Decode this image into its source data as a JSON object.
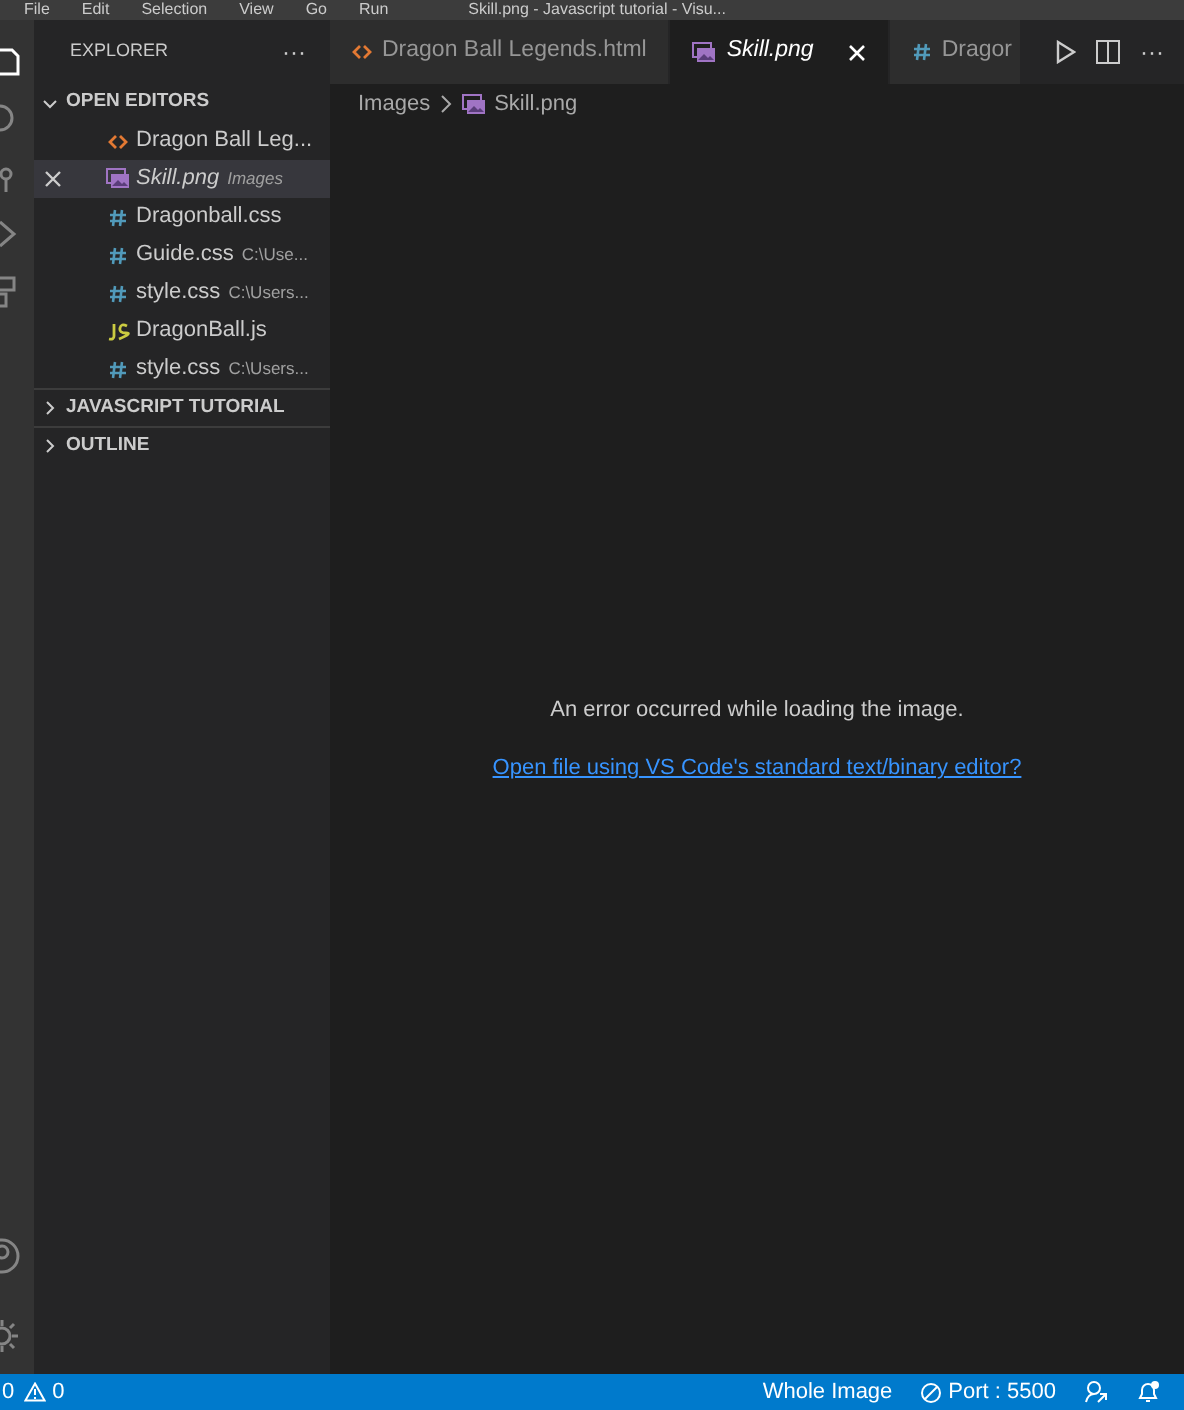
{
  "title_bar": {
    "menu": [
      "File",
      "Edit",
      "Selection",
      "View",
      "Go",
      "Run"
    ],
    "title": "Skill.png - Javascript tutorial - Visu..."
  },
  "sidebar": {
    "title": "EXPLORER",
    "more": "···",
    "sections": [
      {
        "label": "OPEN EDITORS",
        "expanded": true,
        "items": [
          {
            "name": "Dragon Ball Leg...",
            "kind": "html",
            "selected": false,
            "italic": false
          },
          {
            "name": "Skill.png",
            "kind": "image",
            "detail": "Images",
            "selected": true,
            "italic": true
          },
          {
            "name": "Dragonball.css",
            "kind": "css",
            "selected": false,
            "italic": false
          },
          {
            "name": "Guide.css",
            "kind": "css",
            "detail": "C:\\Use...",
            "selected": false,
            "italic": false
          },
          {
            "name": "style.css",
            "kind": "css",
            "detail": "C:\\Users...",
            "selected": false,
            "italic": false
          },
          {
            "name": "DragonBall.js",
            "kind": "js",
            "selected": false,
            "italic": false
          },
          {
            "name": "style.css",
            "kind": "css",
            "detail": "C:\\Users...",
            "selected": false,
            "italic": false
          }
        ]
      },
      {
        "label": "JAVASCRIPT TUTORIAL",
        "expanded": false
      },
      {
        "label": "OUTLINE",
        "expanded": false
      }
    ]
  },
  "tabs": [
    {
      "label": "Dragon Ball Legends.html",
      "kind": "html",
      "selected": false,
      "italic": false
    },
    {
      "label": "Skill.png",
      "kind": "image",
      "selected": true,
      "italic": true
    },
    {
      "label": "Dragor",
      "kind": "css",
      "selected": false,
      "italic": false
    }
  ],
  "tab_actions_more": "···",
  "breadcrumb": [
    "Images",
    "Skill.png"
  ],
  "editor": {
    "message": "An error occurred while loading the image.",
    "link": "Open file using VS Code's standard text/binary editor?"
  },
  "status_bar": {
    "errors": "0",
    "warnings": "0",
    "items": [
      "Whole Image",
      "Port : 5500"
    ]
  }
}
